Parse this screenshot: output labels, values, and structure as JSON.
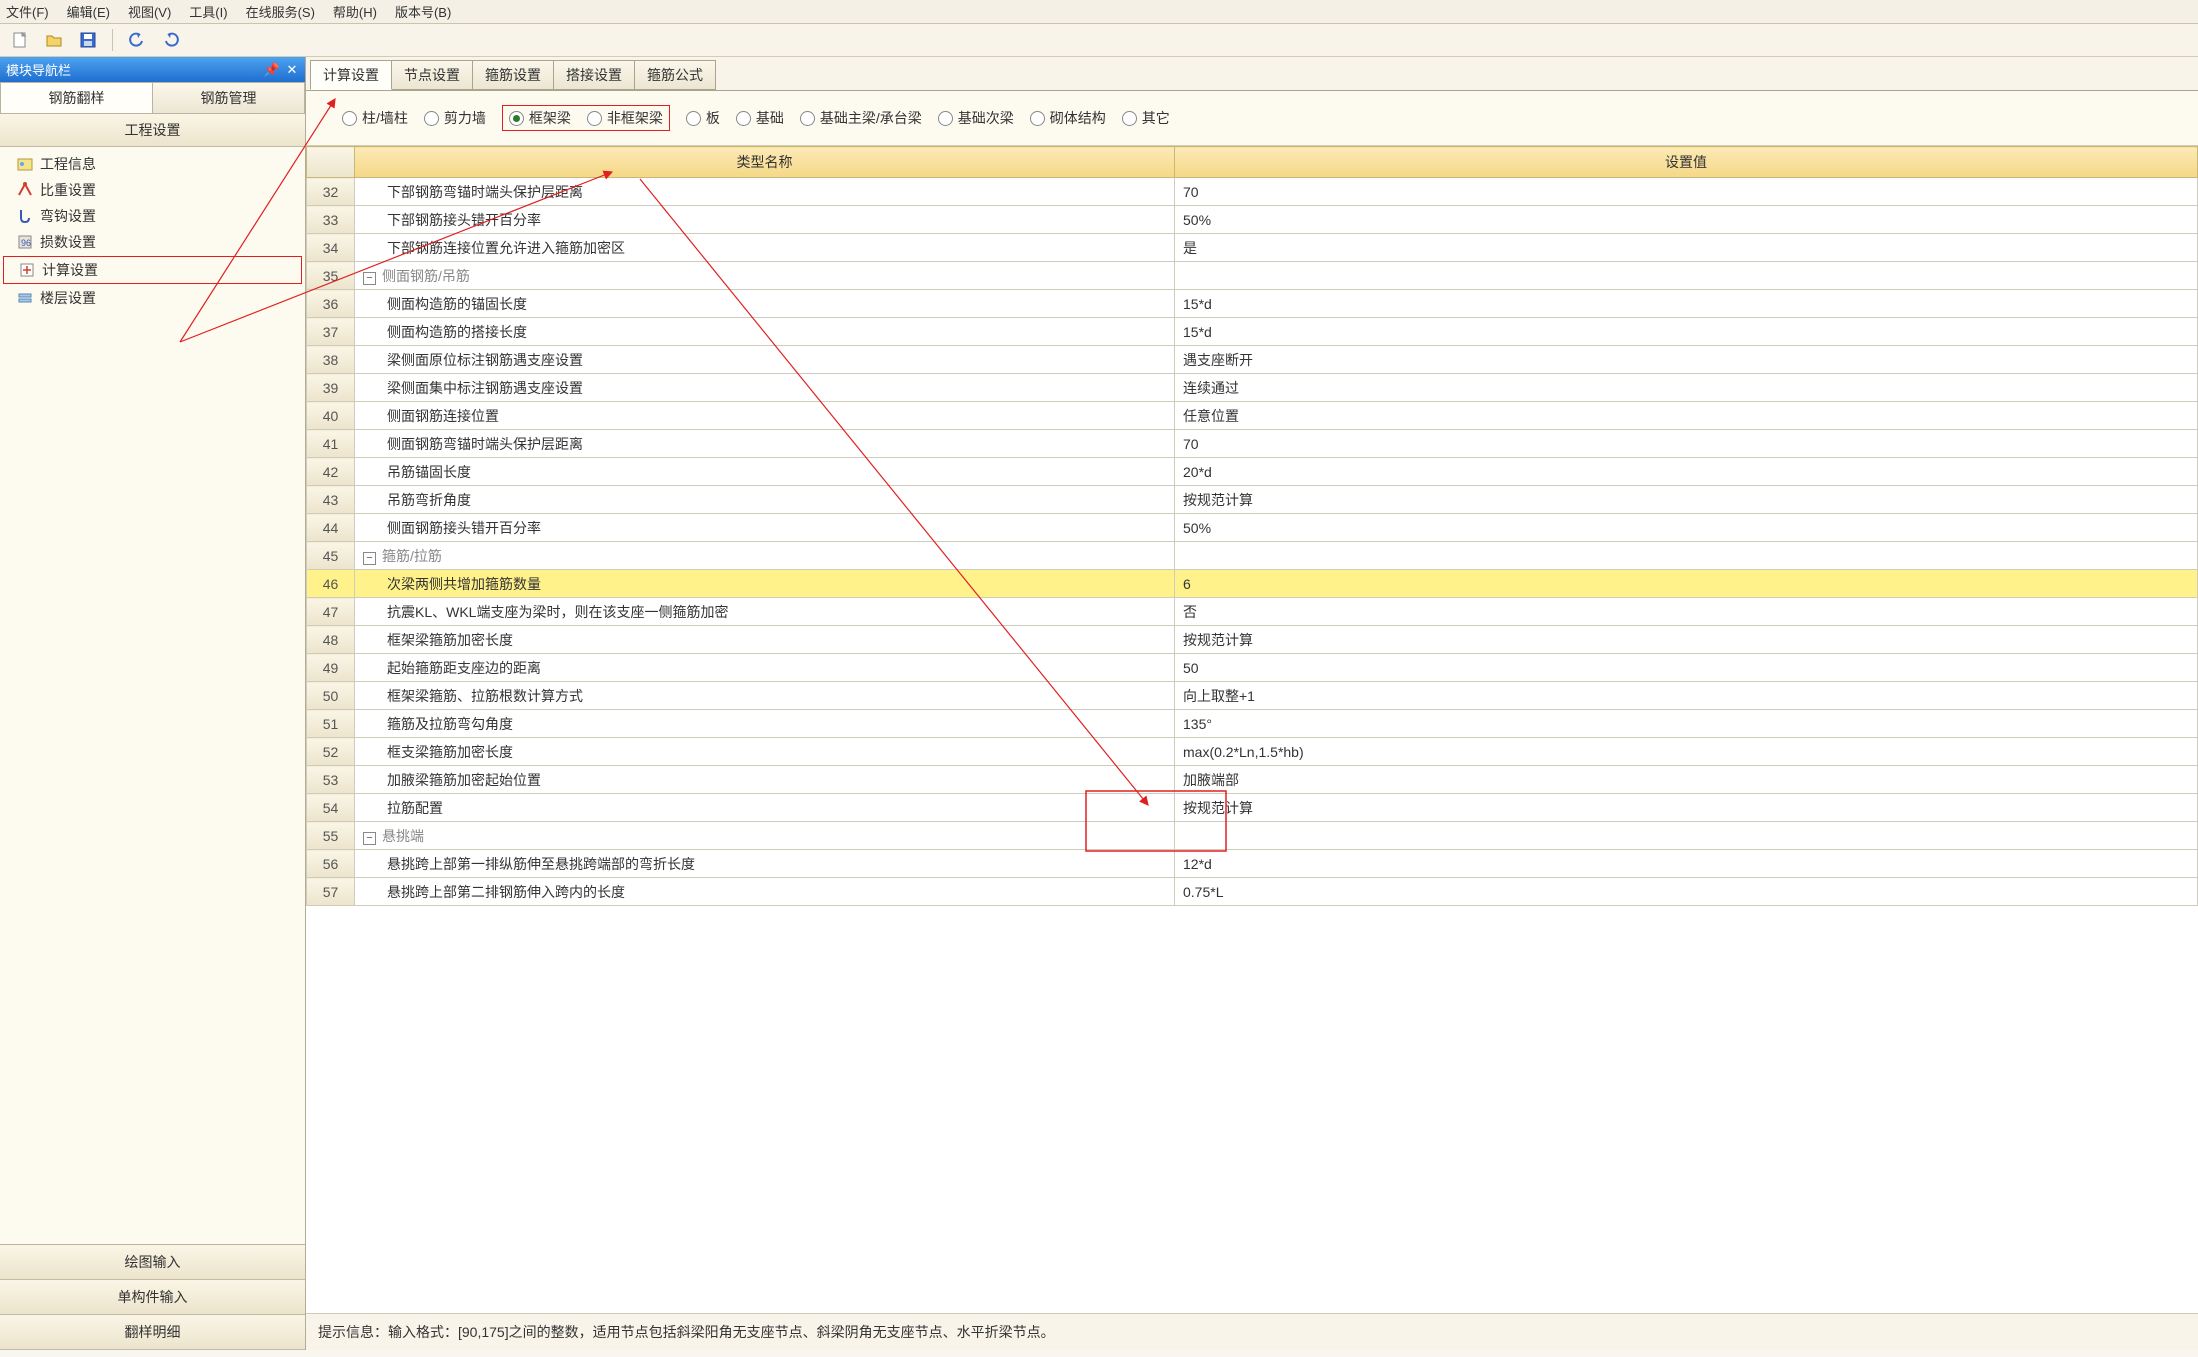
{
  "menu": [
    "文件(F)",
    "编辑(E)",
    "视图(V)",
    "工具(I)",
    "在线服务(S)",
    "帮助(H)",
    "版本号(B)"
  ],
  "sidebar": {
    "title": "模块导航栏",
    "tabs": [
      "钢筋翻样",
      "钢筋管理"
    ],
    "section": "工程设置",
    "items": [
      {
        "icon": "info",
        "label": "工程信息"
      },
      {
        "icon": "weight",
        "label": "比重设置"
      },
      {
        "icon": "hook",
        "label": "弯钩设置"
      },
      {
        "icon": "loss",
        "label": "损数设置"
      },
      {
        "icon": "calc",
        "label": "计算设置"
      },
      {
        "icon": "floor",
        "label": "楼层设置"
      }
    ],
    "bottom": [
      "绘图输入",
      "单构件输入",
      "翻样明细"
    ]
  },
  "settings_tabs": [
    "计算设置",
    "节点设置",
    "箍筋设置",
    "搭接设置",
    "箍筋公式"
  ],
  "radio": [
    {
      "label": "柱/墙柱",
      "checked": false
    },
    {
      "label": "剪力墙",
      "checked": false
    },
    {
      "label": "框架梁",
      "checked": true
    },
    {
      "label": "非框架梁",
      "checked": false
    },
    {
      "label": "板",
      "checked": false
    },
    {
      "label": "基础",
      "checked": false
    },
    {
      "label": "基础主梁/承台梁",
      "checked": false
    },
    {
      "label": "基础次梁",
      "checked": false
    },
    {
      "label": "砌体结构",
      "checked": false
    },
    {
      "label": "其它",
      "checked": false
    }
  ],
  "columns": {
    "name": "类型名称",
    "value": "设置值"
  },
  "rows": [
    {
      "n": 32,
      "lvl": 1,
      "name": "下部钢筋弯锚时端头保护层距离",
      "val": "70"
    },
    {
      "n": 33,
      "lvl": 1,
      "name": "下部钢筋接头错开百分率",
      "val": "50%"
    },
    {
      "n": 34,
      "lvl": 1,
      "name": "下部钢筋连接位置允许进入箍筋加密区",
      "val": "是"
    },
    {
      "n": 35,
      "lvl": 0,
      "group": true,
      "name": "侧面钢筋/吊筋",
      "val": ""
    },
    {
      "n": 36,
      "lvl": 1,
      "name": "侧面构造筋的锚固长度",
      "val": "15*d"
    },
    {
      "n": 37,
      "lvl": 1,
      "name": "侧面构造筋的搭接长度",
      "val": "15*d"
    },
    {
      "n": 38,
      "lvl": 1,
      "name": "梁侧面原位标注钢筋遇支座设置",
      "val": "遇支座断开"
    },
    {
      "n": 39,
      "lvl": 1,
      "name": "梁侧面集中标注钢筋遇支座设置",
      "val": "连续通过"
    },
    {
      "n": 40,
      "lvl": 1,
      "name": "侧面钢筋连接位置",
      "val": "任意位置"
    },
    {
      "n": 41,
      "lvl": 1,
      "name": "侧面钢筋弯锚时端头保护层距离",
      "val": "70"
    },
    {
      "n": 42,
      "lvl": 1,
      "name": "吊筋锚固长度",
      "val": "20*d"
    },
    {
      "n": 43,
      "lvl": 1,
      "name": "吊筋弯折角度",
      "val": "按规范计算"
    },
    {
      "n": 44,
      "lvl": 1,
      "name": "侧面钢筋接头错开百分率",
      "val": "50%"
    },
    {
      "n": 45,
      "lvl": 0,
      "group": true,
      "name": "箍筋/拉筋",
      "val": ""
    },
    {
      "n": 46,
      "lvl": 1,
      "hl": true,
      "name": "次梁两侧共增加箍筋数量",
      "val": "6"
    },
    {
      "n": 47,
      "lvl": 1,
      "name": "抗震KL、WKL端支座为梁时，则在该支座一侧箍筋加密",
      "val": "否"
    },
    {
      "n": 48,
      "lvl": 1,
      "name": "框架梁箍筋加密长度",
      "val": "按规范计算"
    },
    {
      "n": 49,
      "lvl": 1,
      "name": "起始箍筋距支座边的距离",
      "val": "50"
    },
    {
      "n": 50,
      "lvl": 1,
      "name": "框架梁箍筋、拉筋根数计算方式",
      "val": "向上取整+1"
    },
    {
      "n": 51,
      "lvl": 1,
      "name": "箍筋及拉筋弯勾角度",
      "val": "135°"
    },
    {
      "n": 52,
      "lvl": 1,
      "name": "框支梁箍筋加密长度",
      "val": "max(0.2*Ln,1.5*hb)"
    },
    {
      "n": 53,
      "lvl": 1,
      "name": "加腋梁箍筋加密起始位置",
      "val": "加腋端部"
    },
    {
      "n": 54,
      "lvl": 1,
      "name": "拉筋配置",
      "val": "按规范计算"
    },
    {
      "n": 55,
      "lvl": 0,
      "group": true,
      "name": "悬挑端",
      "val": ""
    },
    {
      "n": 56,
      "lvl": 1,
      "name": "悬挑跨上部第一排纵筋伸至悬挑跨端部的弯折长度",
      "val": "12*d"
    },
    {
      "n": 57,
      "lvl": 1,
      "name": "悬挑跨上部第二排钢筋伸入跨内的长度",
      "val": "0.75*L"
    }
  ],
  "hint": "提示信息：输入格式：[90,175]之间的整数，适用节点包括斜梁阳角无支座节点、斜梁阴角无支座节点、水平折梁节点。"
}
